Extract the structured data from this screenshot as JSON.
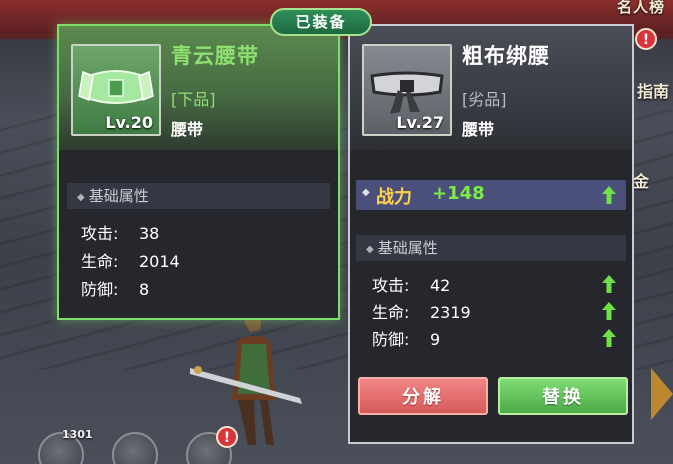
{
  "background": {
    "ranking_label": "名人榜",
    "guide_label": "指南",
    "right_label": "金",
    "notification_mark": "!",
    "chat_count": "1301"
  },
  "equipped_tab": "已装备",
  "equipped_item": {
    "name": "青云腰带",
    "grade": "[下品]",
    "type": "腰带",
    "level": "Lv.20",
    "name_color": "#8fe070",
    "section_title": "基础属性",
    "stats": [
      {
        "label": "攻击:",
        "value": "38"
      },
      {
        "label": "生命:",
        "value": "2014"
      },
      {
        "label": "防御:",
        "value": "8"
      }
    ]
  },
  "compare_item": {
    "name": "粗布绑腰",
    "grade": "[劣品]",
    "type": "腰带",
    "level": "Lv.27",
    "power_label": "战力",
    "power_delta": "+148",
    "section_title": "基础属性",
    "stats": [
      {
        "label": "攻击:",
        "value": "42",
        "trend": "up"
      },
      {
        "label": "生命:",
        "value": "2319",
        "trend": "up"
      },
      {
        "label": "防御:",
        "value": "9",
        "trend": "up"
      }
    ]
  },
  "buttons": {
    "decompose": "分解",
    "replace": "替换"
  },
  "colors": {
    "accent_green": "#7cdd6a",
    "power_yellow": "#ffd24a",
    "up_green": "#7dea4a",
    "decompose_red": "#e86f6f",
    "replace_green": "#66c45c"
  }
}
